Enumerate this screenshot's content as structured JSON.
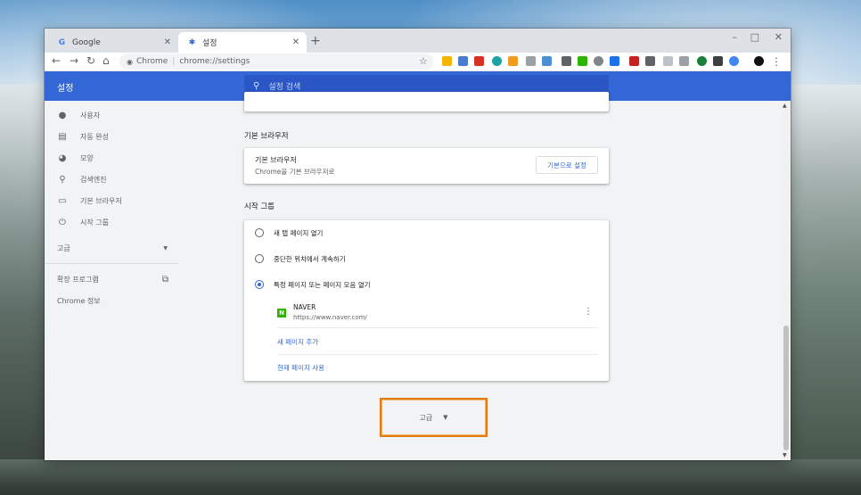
{
  "tabs": [
    {
      "label": "Google",
      "favicon": "google-icon",
      "active": false
    },
    {
      "label": "설정",
      "favicon": "gear-icon",
      "active": true
    }
  ],
  "window_controls": {
    "minimize": "–",
    "maximize": "□",
    "close": "✕"
  },
  "omnibox": {
    "origin": "Chrome",
    "path": "chrome://settings"
  },
  "header": {
    "title": "설정",
    "search_placeholder": "설정 검색"
  },
  "sidebar": {
    "items": [
      {
        "label": "사용자",
        "icon": "person-icon"
      },
      {
        "label": "자동 완성",
        "icon": "clipboard-icon"
      },
      {
        "label": "모양",
        "icon": "palette-icon"
      },
      {
        "label": "검색엔진",
        "icon": "search-icon"
      },
      {
        "label": "기본 브라우저",
        "icon": "browser-icon"
      },
      {
        "label": "시작 그룹",
        "icon": "power-icon"
      }
    ],
    "advanced_label": "고급",
    "extensions_label": "확장 프로그램",
    "about_label": "Chrome 정보"
  },
  "default_browser": {
    "section_title": "기본 브라우저",
    "row_title": "기본 브라우저",
    "row_subtitle": "Chrome을 기본 브라우저로",
    "button_label": "기본으로 설정"
  },
  "startup": {
    "section_title": "시작 그룹",
    "options": [
      {
        "label": "새 탭 페이지 열기",
        "checked": false
      },
      {
        "label": "중단한 위치에서 계속하기",
        "checked": false
      },
      {
        "label": "특정 페이지 또는 페이지 모음 열기",
        "checked": true
      }
    ],
    "page": {
      "name": "NAVER",
      "url": "https://www.naver.com/"
    },
    "add_page_label": "새 페이지 추가",
    "use_current_label": "현재 페이지 사용"
  },
  "advanced_button": {
    "label": "고급"
  },
  "colors": {
    "accent": "#3367d6",
    "highlight_border": "#e07b16",
    "naver_green": "#2db400"
  }
}
